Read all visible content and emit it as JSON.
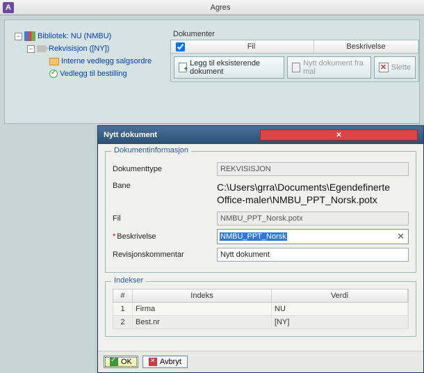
{
  "app": {
    "icon_letter": "A",
    "title": "Agres"
  },
  "tree": {
    "root": "Bibliotek: NU (NMBU)",
    "node1": "Rekvisisjon ([NY])",
    "leaf1": "Interne vedlegg salgsordre",
    "leaf2": "Vedlegg til bestilling"
  },
  "docpanel": {
    "title": "Dokumenter",
    "col_file": "Fil",
    "col_desc": "Beskrivelse",
    "btn_add": "Legg til eksisterende dokument",
    "btn_tmpl": "Nytt dokument fra mal",
    "btn_del": "Slette"
  },
  "dialog": {
    "title": "Nytt dokument",
    "group_info": "Dokumentinformasjon",
    "lbl_type": "Dokumenttype",
    "val_type": "REKVISISJON",
    "lbl_path": "Bane",
    "val_path": "C:\\Users\\grra\\Documents\\Egendefinerte Office-maler\\NMBU_PPT_Norsk.potx",
    "lbl_file": "Fil",
    "val_file": "NMBU_PPT_Norsk.potx",
    "lbl_desc": "Beskrivelse",
    "val_desc": "NMBU_PPT_Norsk",
    "lbl_rev": "Revisjonskommentar",
    "val_rev": "Nytt dokument",
    "group_idx": "Indekser",
    "col_num": "#",
    "col_idx": "Indeks",
    "col_val": "Verdi",
    "rows": [
      {
        "n": "1",
        "idx": "Firma",
        "val": "NU"
      },
      {
        "n": "2",
        "idx": "Best.nr",
        "val": "[NY]"
      }
    ],
    "btn_ok": "OK",
    "btn_cancel": "Avbryt"
  }
}
